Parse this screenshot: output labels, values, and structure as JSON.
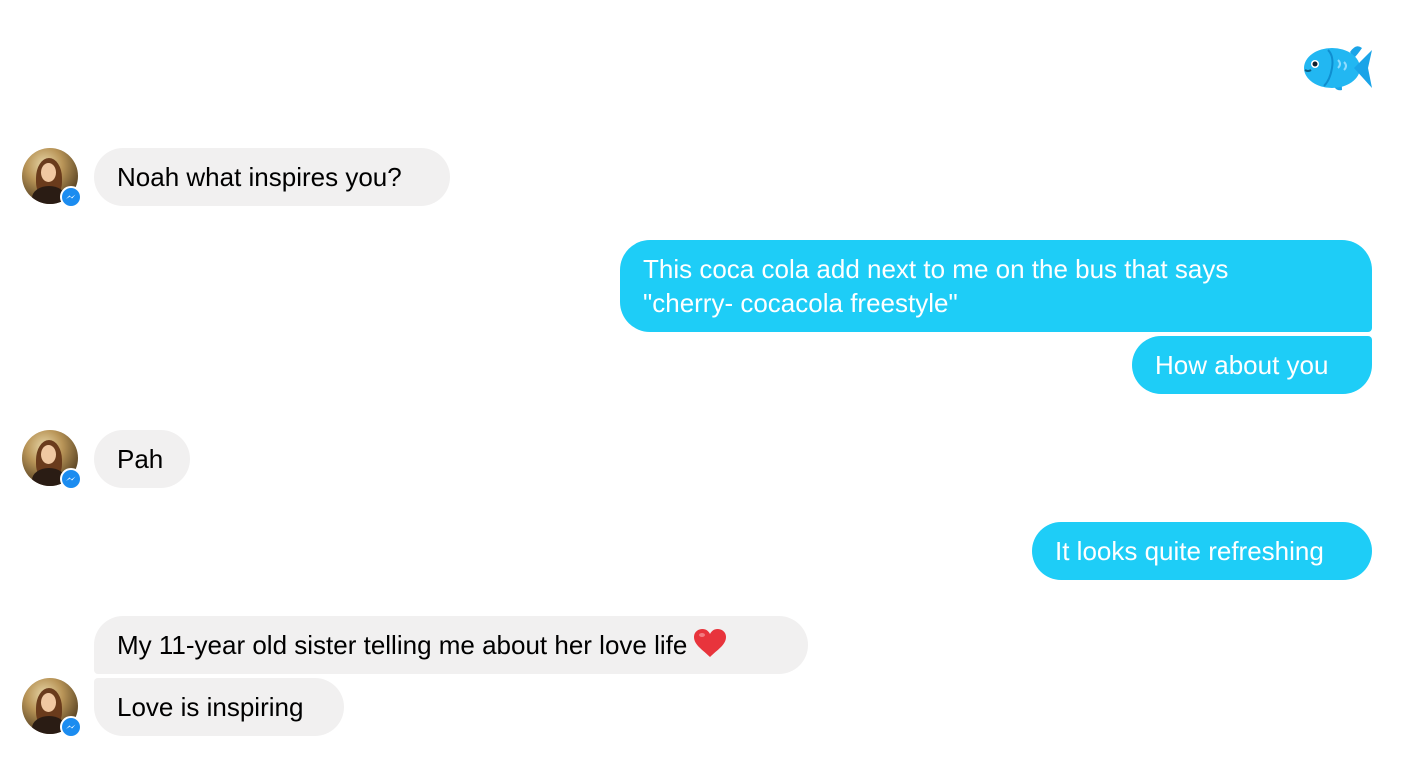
{
  "header": {
    "emoji_icon": "fish-emoji-icon"
  },
  "conversation": {
    "contact_avatar_icon": "contact-avatar",
    "badge_icon": "messenger-badge-icon",
    "colors": {
      "incoming_bubble": "#f1f0f0",
      "outgoing_bubble": "#1ecdf7",
      "incoming_text": "#000000",
      "outgoing_text": "#ffffff",
      "badge": "#1b8cf0"
    },
    "messages": [
      {
        "direction": "incoming",
        "text": "Noah what inspires you?"
      },
      {
        "direction": "outgoing",
        "lines": [
          "This coca cola add next to me on the bus that says",
          "\"cherry- cocacola freestyle\""
        ]
      },
      {
        "direction": "outgoing",
        "text": "How about you"
      },
      {
        "direction": "incoming",
        "text": "Pah"
      },
      {
        "direction": "outgoing",
        "text": "It looks quite refreshing"
      },
      {
        "direction": "incoming",
        "text": "My 11-year old sister telling me about her love life",
        "emoji": "heart-emoji-icon"
      },
      {
        "direction": "incoming",
        "text": "Love is inspiring"
      }
    ]
  }
}
